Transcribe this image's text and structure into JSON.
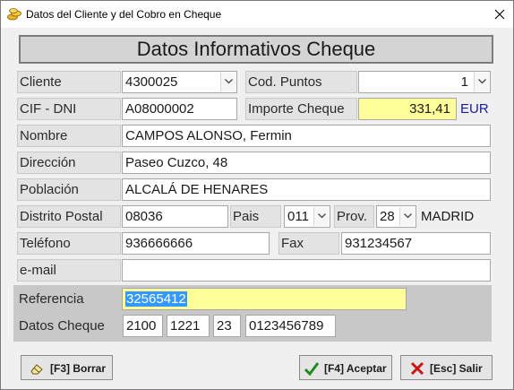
{
  "window": {
    "title": "Datos del Cliente y del Cobro en Cheque"
  },
  "banner": {
    "title": "Datos Informativos Cheque"
  },
  "labels": {
    "cliente": "Cliente",
    "cod_puntos": "Cod. Puntos",
    "cif_dni": "CIF - DNI",
    "importe": "Importe Cheque",
    "nombre": "Nombre",
    "direccion": "Dirección",
    "poblacion": "Población",
    "distrito_postal": "Distrito Postal",
    "pais": "Pais",
    "prov": "Prov.",
    "telefono": "Teléfono",
    "fax": "Fax",
    "email": "e-mail",
    "referencia": "Referencia",
    "datos_cheque": "Datos Cheque"
  },
  "fields": {
    "cliente": "4300025",
    "cod_puntos": "1",
    "cif_dni": "A08000002",
    "importe": "331,41",
    "currency": "EUR",
    "nombre": "CAMPOS ALONSO, Fermin",
    "direccion": "Paseo Cuzco, 48",
    "poblacion": "ALCALÁ DE HENARES",
    "distrito_postal": "08036",
    "pais": "011",
    "prov": "28",
    "prov_name": "MADRID",
    "telefono": "936666666",
    "fax": "931234567",
    "email": "",
    "referencia": "32565412",
    "cheque": [
      "2100",
      "1221",
      "23",
      "0123456789"
    ]
  },
  "buttons": {
    "borrar": "[F3] Borrar",
    "aceptar": "[F4] Aceptar",
    "salir": "[Esc] Salir"
  },
  "colors": {
    "highlight_field": "#ffff99",
    "selection": "#3399ff",
    "currency": "#1a1aa0"
  },
  "icons": {
    "app": "coins-icon",
    "close": "close-icon",
    "combo": "chevron-down-icon",
    "borrar": "eraser-icon",
    "aceptar": "checkmark-icon",
    "salir": "x-mark-icon"
  }
}
